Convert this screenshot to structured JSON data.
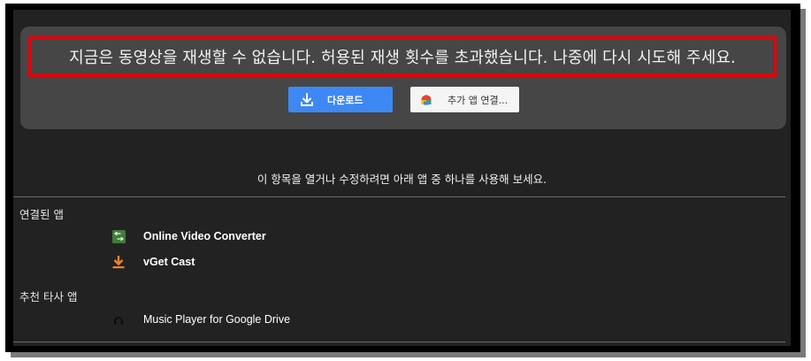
{
  "banner": {
    "error_message": "지금은 동영상을 재생할 수 없습니다. 허용된 재생 횟수를 초과했습니다. 나중에 다시 시도해 주세요.",
    "download_label": "다운로드",
    "connect_label": "추가 앱 연결..."
  },
  "main": {
    "instructions": "이 항목을 열거나 수정하려면 아래 앱 중 하나를 사용해 보세요.",
    "connected_section": {
      "title": "연결된 앱",
      "apps": [
        {
          "name": "Online Video Converter",
          "icon": "video-converter-icon"
        },
        {
          "name": "vGet Cast",
          "icon": "download-arrow-icon"
        }
      ]
    },
    "suggested_section": {
      "title": "추천 타사 앱",
      "apps": [
        {
          "name": "Music Player for Google Drive",
          "icon": "headphones-icon"
        }
      ]
    }
  },
  "colors": {
    "highlight_border": "#e3000b",
    "download_button": "#3d88f4",
    "background": "#222222",
    "panel": "#464646"
  }
}
